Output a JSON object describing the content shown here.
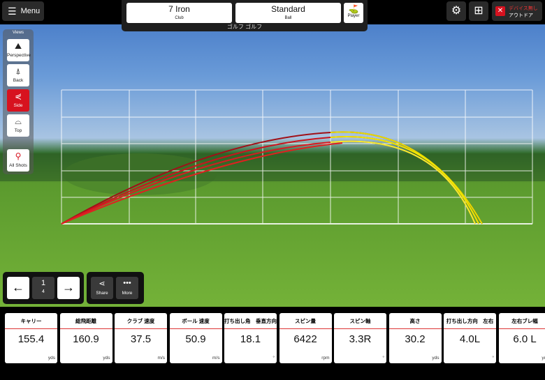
{
  "header": {
    "menu_label": "Menu",
    "club_value": "7 Iron",
    "club_label": "Club",
    "ball_value": "Standard",
    "ball_label": "Ball",
    "player_label": "Player",
    "player_name": "ゴルフ ゴルフ",
    "device_line1": "デバイス無し",
    "device_line2": "アウトドア"
  },
  "views": {
    "title": "Views",
    "items": [
      {
        "label": "Perspective",
        "icon": "perspective-icon"
      },
      {
        "label": "Back",
        "icon": "back-view-icon"
      },
      {
        "label": "Side",
        "icon": "side-view-icon",
        "active": true
      },
      {
        "label": "Top",
        "icon": "top-view-icon"
      }
    ],
    "all_shots": "All Shots"
  },
  "shot_nav": {
    "current": "1",
    "total": "4",
    "share": "Share",
    "more": "More"
  },
  "stats": [
    {
      "label": "キャリー",
      "value": "155.4",
      "unit": "yds"
    },
    {
      "label": "総飛距離",
      "value": "160.9",
      "unit": "yds"
    },
    {
      "label": "クラブ 速度",
      "value": "37.5",
      "unit": "m/s"
    },
    {
      "label": "ボール 速度",
      "value": "50.9",
      "unit": "m/s"
    },
    {
      "label": "打ち出し角　垂直方向",
      "value": "18.1",
      "unit": "°"
    },
    {
      "label": "スピン量",
      "value": "6422",
      "unit": "rpm"
    },
    {
      "label": "スピン軸",
      "value": "3.3R",
      "unit": "°"
    },
    {
      "label": "高さ",
      "value": "30.2",
      "unit": "yds"
    },
    {
      "label": "打ち出し方向　左右",
      "value": "4.0L",
      "unit": "°"
    },
    {
      "label": "左右ブレ幅",
      "value": "6.0 L",
      "unit": "yds"
    }
  ],
  "colors": {
    "accent": "#d7121f",
    "trajectory_ascent": "#c8141e",
    "trajectory_descent": "#f0e800"
  }
}
